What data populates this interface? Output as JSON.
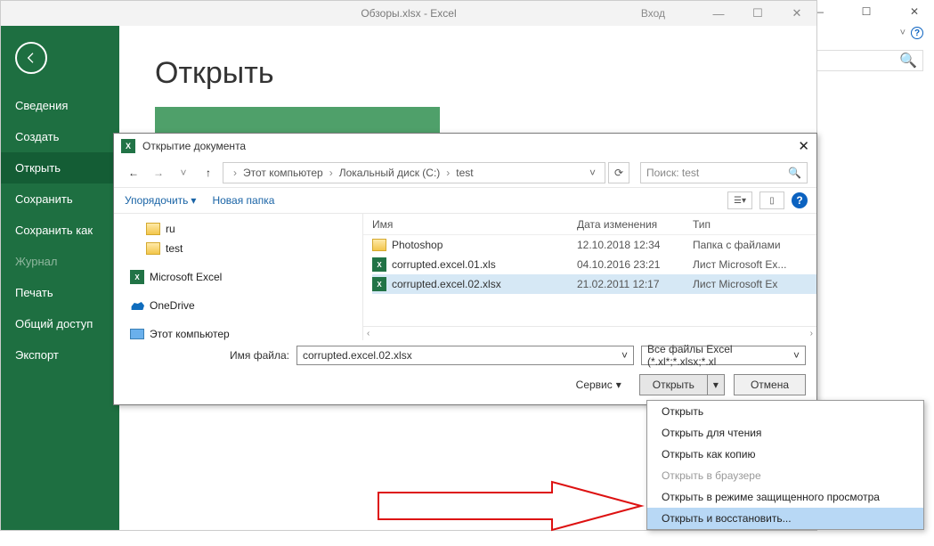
{
  "outer": {
    "caret": "˅",
    "help_icon": "?",
    "search_icon": "🔍"
  },
  "excel": {
    "title": "Обзоры.xlsx - Excel",
    "login": "Вход",
    "win_min": "—",
    "win_max": "☐",
    "win_close": "✕"
  },
  "sidebar": {
    "items": [
      {
        "label": "Сведения"
      },
      {
        "label": "Создать"
      },
      {
        "label": "Открыть"
      },
      {
        "label": "Сохранить"
      },
      {
        "label": "Сохранить как"
      },
      {
        "label": "Журнал"
      },
      {
        "label": "Печать"
      },
      {
        "label": "Общий доступ"
      },
      {
        "label": "Экспорт"
      }
    ]
  },
  "main": {
    "heading": "Открыть"
  },
  "dialog": {
    "title": "Открытие документа",
    "breadcrumb": [
      "Этот компьютер",
      "Локальный диск (C:)",
      "test"
    ],
    "search_placeholder": "Поиск: test",
    "toolbar": {
      "organize": "Упорядочить",
      "newfolder": "Новая папка"
    },
    "tree": [
      {
        "label": "ru",
        "type": "folder",
        "indent": true
      },
      {
        "label": "test",
        "type": "folder",
        "indent": true
      },
      {
        "label": "Microsoft Excel",
        "type": "excel",
        "indent": false
      },
      {
        "label": "OneDrive",
        "type": "onedrive",
        "indent": false
      },
      {
        "label": "Этот компьютер",
        "type": "pc",
        "indent": false
      }
    ],
    "columns": [
      "Имя",
      "Дата изменения",
      "Тип"
    ],
    "rows": [
      {
        "name": "Photoshop",
        "date": "12.10.2018 12:34",
        "type": "Папка с файлами",
        "kind": "folder",
        "sel": false
      },
      {
        "name": "corrupted.excel.01.xls",
        "date": "04.10.2016 23:21",
        "type": "Лист Microsoft Ex...",
        "kind": "excel",
        "sel": false
      },
      {
        "name": "corrupted.excel.02.xlsx",
        "date": "21.02.2011 12:17",
        "type": "Лист Microsoft Ex",
        "kind": "excel",
        "sel": true
      }
    ],
    "filename_label": "Имя файла:",
    "filename_value": "corrupted.excel.02.xlsx",
    "filter": "Все файлы Excel (*.xl*;*.xlsx;*.xl",
    "tools_label": "Сервис",
    "open_label": "Открыть",
    "cancel_label": "Отмена"
  },
  "dropdown": {
    "items": [
      {
        "label": "Открыть",
        "state": "normal"
      },
      {
        "label": "Открыть для чтения",
        "state": "normal"
      },
      {
        "label": "Открыть как копию",
        "state": "normal"
      },
      {
        "label": "Открыть в браузере",
        "state": "disabled"
      },
      {
        "label": "Открыть в режиме защищенного просмотра",
        "state": "normal"
      },
      {
        "label": "Открыть и восстановить...",
        "state": "highlight"
      }
    ]
  }
}
